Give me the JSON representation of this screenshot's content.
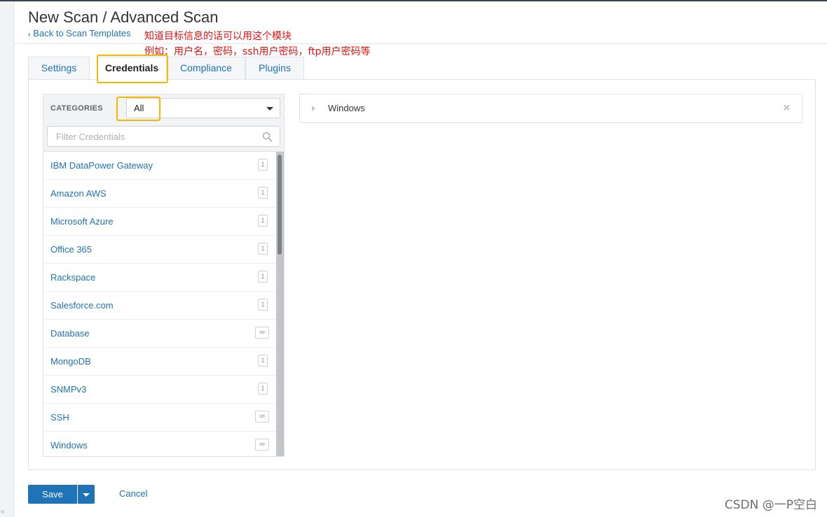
{
  "header": {
    "title": "New Scan / Advanced Scan",
    "back_link": "Back to Scan Templates"
  },
  "annotations": {
    "line1": "知道目标信息的话可以用这个模块",
    "line2": "例如：用户名，密码，ssh用户密码，ftp用户密码等",
    "highlight_color": "#f5b800",
    "text_color": "#ee1111"
  },
  "tabs": [
    {
      "label": "Settings",
      "active": false
    },
    {
      "label": "Credentials",
      "active": true
    },
    {
      "label": "Compliance",
      "active": false
    },
    {
      "label": "Plugins",
      "active": false
    }
  ],
  "categories": {
    "label": "CATEGORIES",
    "selected": "All",
    "filter_placeholder": "Filter Credentials",
    "items": [
      {
        "name": "IBM DataPower Gateway",
        "count": "1"
      },
      {
        "name": "Amazon AWS",
        "count": "1"
      },
      {
        "name": "Microsoft Azure",
        "count": "1"
      },
      {
        "name": "Office 365",
        "count": "1"
      },
      {
        "name": "Rackspace",
        "count": "1"
      },
      {
        "name": "Salesforce.com",
        "count": "1"
      },
      {
        "name": "Database",
        "count": "∞"
      },
      {
        "name": "MongoDB",
        "count": "1"
      },
      {
        "name": "SNMPv3",
        "count": "1"
      },
      {
        "name": "SSH",
        "count": "∞"
      },
      {
        "name": "Windows",
        "count": "∞"
      }
    ]
  },
  "credentials": [
    {
      "name": "Windows"
    }
  ],
  "footer": {
    "save_label": "Save",
    "cancel_label": "Cancel"
  },
  "watermark": "CSDN @一P空白",
  "colors": {
    "link": "#1f73b7",
    "primary_button": "#1f73b7"
  }
}
